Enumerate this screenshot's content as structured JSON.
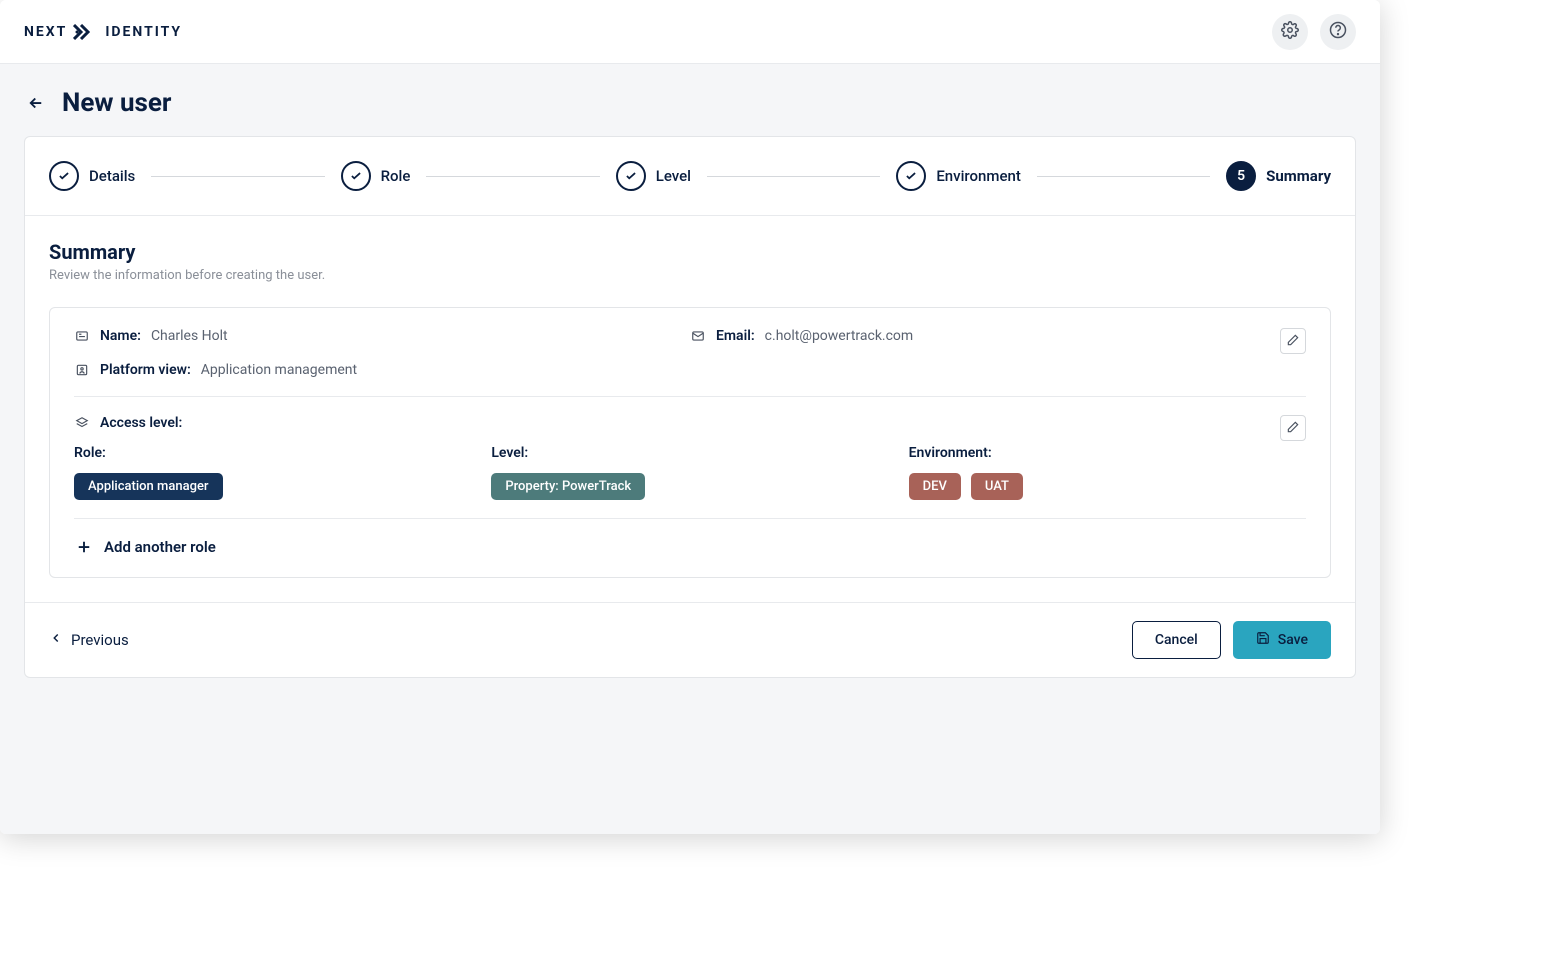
{
  "brand": {
    "part1": "NEXT",
    "part2": "IDENTITY"
  },
  "page": {
    "title": "New user"
  },
  "steps": [
    {
      "label": "Details",
      "done": true
    },
    {
      "label": "Role",
      "done": true
    },
    {
      "label": "Level",
      "done": true
    },
    {
      "label": "Environment",
      "done": true
    },
    {
      "label": "Summary",
      "current": true,
      "number": "5"
    }
  ],
  "section": {
    "title": "Summary",
    "subtitle": "Review the information before creating the user."
  },
  "summary": {
    "name_label": "Name:",
    "name_value": "Charles Holt",
    "email_label": "Email:",
    "email_value": "c.holt@powertrack.com",
    "platform_label": "Platform view:",
    "platform_value": "Application management",
    "access_label": "Access level:",
    "role_head": "Role:",
    "level_head": "Level:",
    "env_head": "Environment:",
    "role_value": "Application manager",
    "level_value": "Property: PowerTrack",
    "env_values": [
      "DEV",
      "UAT"
    ],
    "add_role": "Add another role"
  },
  "footer": {
    "previous": "Previous",
    "cancel": "Cancel",
    "save": "Save"
  }
}
